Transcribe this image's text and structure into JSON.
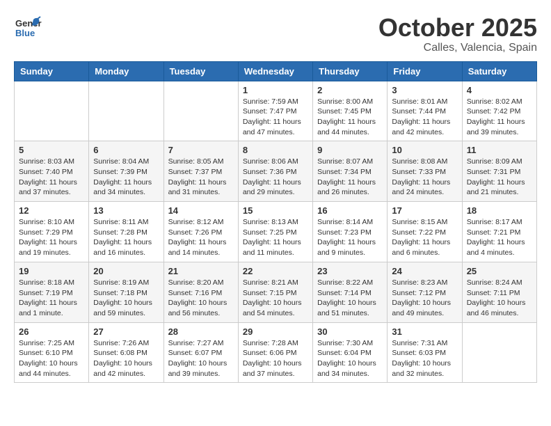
{
  "header": {
    "logo_general": "General",
    "logo_blue": "Blue",
    "month_title": "October 2025",
    "location": "Calles, Valencia, Spain"
  },
  "weekdays": [
    "Sunday",
    "Monday",
    "Tuesday",
    "Wednesday",
    "Thursday",
    "Friday",
    "Saturday"
  ],
  "weeks": [
    [
      {
        "day": "",
        "info": ""
      },
      {
        "day": "",
        "info": ""
      },
      {
        "day": "",
        "info": ""
      },
      {
        "day": "1",
        "info": "Sunrise: 7:59 AM\nSunset: 7:47 PM\nDaylight: 11 hours and 47 minutes."
      },
      {
        "day": "2",
        "info": "Sunrise: 8:00 AM\nSunset: 7:45 PM\nDaylight: 11 hours and 44 minutes."
      },
      {
        "day": "3",
        "info": "Sunrise: 8:01 AM\nSunset: 7:44 PM\nDaylight: 11 hours and 42 minutes."
      },
      {
        "day": "4",
        "info": "Sunrise: 8:02 AM\nSunset: 7:42 PM\nDaylight: 11 hours and 39 minutes."
      }
    ],
    [
      {
        "day": "5",
        "info": "Sunrise: 8:03 AM\nSunset: 7:40 PM\nDaylight: 11 hours and 37 minutes."
      },
      {
        "day": "6",
        "info": "Sunrise: 8:04 AM\nSunset: 7:39 PM\nDaylight: 11 hours and 34 minutes."
      },
      {
        "day": "7",
        "info": "Sunrise: 8:05 AM\nSunset: 7:37 PM\nDaylight: 11 hours and 31 minutes."
      },
      {
        "day": "8",
        "info": "Sunrise: 8:06 AM\nSunset: 7:36 PM\nDaylight: 11 hours and 29 minutes."
      },
      {
        "day": "9",
        "info": "Sunrise: 8:07 AM\nSunset: 7:34 PM\nDaylight: 11 hours and 26 minutes."
      },
      {
        "day": "10",
        "info": "Sunrise: 8:08 AM\nSunset: 7:33 PM\nDaylight: 11 hours and 24 minutes."
      },
      {
        "day": "11",
        "info": "Sunrise: 8:09 AM\nSunset: 7:31 PM\nDaylight: 11 hours and 21 minutes."
      }
    ],
    [
      {
        "day": "12",
        "info": "Sunrise: 8:10 AM\nSunset: 7:29 PM\nDaylight: 11 hours and 19 minutes."
      },
      {
        "day": "13",
        "info": "Sunrise: 8:11 AM\nSunset: 7:28 PM\nDaylight: 11 hours and 16 minutes."
      },
      {
        "day": "14",
        "info": "Sunrise: 8:12 AM\nSunset: 7:26 PM\nDaylight: 11 hours and 14 minutes."
      },
      {
        "day": "15",
        "info": "Sunrise: 8:13 AM\nSunset: 7:25 PM\nDaylight: 11 hours and 11 minutes."
      },
      {
        "day": "16",
        "info": "Sunrise: 8:14 AM\nSunset: 7:23 PM\nDaylight: 11 hours and 9 minutes."
      },
      {
        "day": "17",
        "info": "Sunrise: 8:15 AM\nSunset: 7:22 PM\nDaylight: 11 hours and 6 minutes."
      },
      {
        "day": "18",
        "info": "Sunrise: 8:17 AM\nSunset: 7:21 PM\nDaylight: 11 hours and 4 minutes."
      }
    ],
    [
      {
        "day": "19",
        "info": "Sunrise: 8:18 AM\nSunset: 7:19 PM\nDaylight: 11 hours and 1 minute."
      },
      {
        "day": "20",
        "info": "Sunrise: 8:19 AM\nSunset: 7:18 PM\nDaylight: 10 hours and 59 minutes."
      },
      {
        "day": "21",
        "info": "Sunrise: 8:20 AM\nSunset: 7:16 PM\nDaylight: 10 hours and 56 minutes."
      },
      {
        "day": "22",
        "info": "Sunrise: 8:21 AM\nSunset: 7:15 PM\nDaylight: 10 hours and 54 minutes."
      },
      {
        "day": "23",
        "info": "Sunrise: 8:22 AM\nSunset: 7:14 PM\nDaylight: 10 hours and 51 minutes."
      },
      {
        "day": "24",
        "info": "Sunrise: 8:23 AM\nSunset: 7:12 PM\nDaylight: 10 hours and 49 minutes."
      },
      {
        "day": "25",
        "info": "Sunrise: 8:24 AM\nSunset: 7:11 PM\nDaylight: 10 hours and 46 minutes."
      }
    ],
    [
      {
        "day": "26",
        "info": "Sunrise: 7:25 AM\nSunset: 6:10 PM\nDaylight: 10 hours and 44 minutes."
      },
      {
        "day": "27",
        "info": "Sunrise: 7:26 AM\nSunset: 6:08 PM\nDaylight: 10 hours and 42 minutes."
      },
      {
        "day": "28",
        "info": "Sunrise: 7:27 AM\nSunset: 6:07 PM\nDaylight: 10 hours and 39 minutes."
      },
      {
        "day": "29",
        "info": "Sunrise: 7:28 AM\nSunset: 6:06 PM\nDaylight: 10 hours and 37 minutes."
      },
      {
        "day": "30",
        "info": "Sunrise: 7:30 AM\nSunset: 6:04 PM\nDaylight: 10 hours and 34 minutes."
      },
      {
        "day": "31",
        "info": "Sunrise: 7:31 AM\nSunset: 6:03 PM\nDaylight: 10 hours and 32 minutes."
      },
      {
        "day": "",
        "info": ""
      }
    ]
  ]
}
